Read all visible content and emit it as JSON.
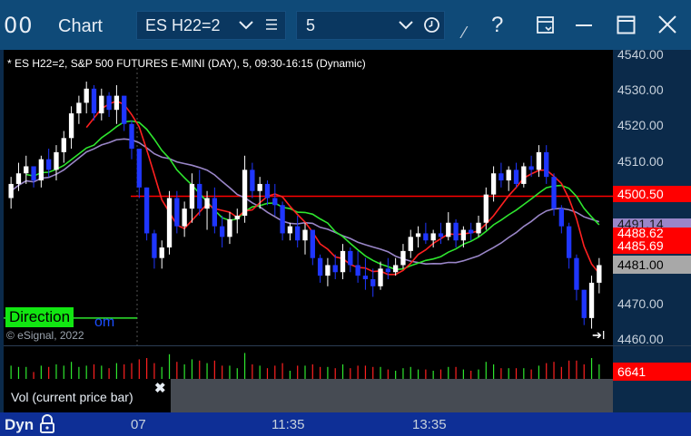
{
  "titlebar": {
    "link_glyph": "00",
    "title": "Chart",
    "symbol": "ES H22=2",
    "interval": "5",
    "help_glyph": "?",
    "cursor_glyph": "⁄",
    "icons": [
      "link-icon",
      "chevron-down-icon",
      "list-icon",
      "clock-icon",
      "cursor-icon",
      "help-icon",
      "template-icon",
      "minimize-icon",
      "maximize-icon",
      "close-icon"
    ]
  },
  "chart": {
    "title": "* ES H22=2, S&P 500 FUTURES E-MINI (DAY), 5, 09:30-16:15 (Dynamic)",
    "indicator_label": "Direction",
    "indicator_label_suffix": "om",
    "copyright": "© eSignal, 2022",
    "jump_glyph": "➔I",
    "price_ticks": [
      "4540.00",
      "4530.00",
      "4520.00",
      "4510.00",
      "4500.50",
      "4491.14",
      "4488.62",
      "4485.69",
      "4481.00",
      "4470.00",
      "4460.00"
    ],
    "price_badges": [
      {
        "label": "4500.50",
        "bg": "#ff0000",
        "fg": "#ffffff"
      },
      {
        "label": "4491.14",
        "bg": "#9a86c8",
        "fg": "#1a1a1a"
      },
      {
        "label": "4488.62",
        "bg": "#ff0000",
        "fg": "#ffffff"
      },
      {
        "label": "4485.69",
        "bg": "#ff0000",
        "fg": "#ffffff"
      },
      {
        "label": "4481.00",
        "bg": "#a8a8a8",
        "fg": "#000000"
      }
    ],
    "colors": {
      "up": "#ffffff",
      "down": "#1f36ff",
      "ma_fast": "#ff2020",
      "ma_slow": "#2ee62e",
      "vwap": "#9a86c8",
      "level": "#ff0000",
      "level_green": "#2ee62e"
    }
  },
  "chart_data": {
    "type": "candlestick",
    "symbol": "ES H22=2",
    "ylim": [
      4458,
      4542
    ],
    "candles": [
      [
        4500,
        4506,
        4497,
        4504
      ],
      [
        4504,
        4510,
        4502,
        4507
      ],
      [
        4507,
        4512,
        4504,
        4509
      ],
      [
        4509,
        4507,
        4503,
        4505
      ],
      [
        4505,
        4512,
        4503,
        4511
      ],
      [
        4511,
        4514,
        4506,
        4508
      ],
      [
        4508,
        4515,
        4505,
        4513
      ],
      [
        4513,
        4519,
        4510,
        4517
      ],
      [
        4517,
        4526,
        4514,
        4524
      ],
      [
        4524,
        4529,
        4521,
        4527
      ],
      [
        4527,
        4533,
        4524,
        4531
      ],
      [
        4531,
        4532,
        4522,
        4524
      ],
      [
        4524,
        4531,
        4522,
        4529
      ],
      [
        4529,
        4530,
        4523,
        4525
      ],
      [
        4525,
        4532,
        4521,
        4529
      ],
      [
        4529,
        4529,
        4519,
        4521
      ],
      [
        4521,
        4522,
        4511,
        4514
      ],
      [
        4514,
        4514,
        4500,
        4503
      ],
      [
        4503,
        4503,
        4488,
        4490
      ],
      [
        4490,
        4491,
        4480,
        4483
      ],
      [
        4483,
        4488,
        4480,
        4486
      ],
      [
        4486,
        4502,
        4484,
        4500
      ],
      [
        4500,
        4502,
        4490,
        4492
      ],
      [
        4492,
        4499,
        4489,
        4497
      ],
      [
        4497,
        4507,
        4493,
        4504
      ],
      [
        4504,
        4508,
        4495,
        4497
      ],
      [
        4497,
        4502,
        4491,
        4500
      ],
      [
        4500,
        4503,
        4490,
        4492
      ],
      [
        4492,
        4495,
        4486,
        4489
      ],
      [
        4489,
        4496,
        4487,
        4494
      ],
      [
        4494,
        4497,
        4490,
        4495
      ],
      [
        4495,
        4512,
        4493,
        4508
      ],
      [
        4508,
        4510,
        4500,
        4502
      ],
      [
        4502,
        4506,
        4497,
        4504
      ],
      [
        4504,
        4505,
        4498,
        4500
      ],
      [
        4500,
        4504,
        4495,
        4498
      ],
      [
        4498,
        4499,
        4488,
        4490
      ],
      [
        4490,
        4493,
        4488,
        4492
      ],
      [
        4492,
        4495,
        4486,
        4488
      ],
      [
        4488,
        4493,
        4484,
        4491
      ],
      [
        4491,
        4491,
        4481,
        4483
      ],
      [
        4483,
        4484,
        4476,
        4478
      ],
      [
        4478,
        4483,
        4475,
        4481
      ],
      [
        4481,
        4484,
        4477,
        4479
      ],
      [
        4479,
        4487,
        4477,
        4485
      ],
      [
        4485,
        4486,
        4479,
        4481
      ],
      [
        4481,
        4485,
        4476,
        4478
      ],
      [
        4478,
        4483,
        4474,
        4477
      ],
      [
        4477,
        4480,
        4472,
        4475
      ],
      [
        4475,
        4482,
        4474,
        4480
      ],
      [
        4480,
        4483,
        4477,
        4479
      ],
      [
        4479,
        4483,
        4478,
        4481
      ],
      [
        4481,
        4487,
        4480,
        4485
      ],
      [
        4485,
        4491,
        4483,
        4489
      ],
      [
        4489,
        4492,
        4486,
        4490
      ],
      [
        4490,
        4493,
        4487,
        4488
      ],
      [
        4488,
        4491,
        4486,
        4490
      ],
      [
        4490,
        4493,
        4487,
        4489
      ],
      [
        4489,
        4496,
        4488,
        4493
      ],
      [
        4493,
        4494,
        4486,
        4488
      ],
      [
        4488,
        4492,
        4486,
        4491
      ],
      [
        4491,
        4493,
        4488,
        4490
      ],
      [
        4490,
        4495,
        4489,
        4493
      ],
      [
        4493,
        4503,
        4491,
        4501
      ],
      [
        4501,
        4509,
        4499,
        4507
      ],
      [
        4507,
        4510,
        4503,
        4505
      ],
      [
        4505,
        4509,
        4502,
        4508
      ],
      [
        4508,
        4510,
        4503,
        4504
      ],
      [
        4504,
        4510,
        4503,
        4509
      ],
      [
        4509,
        4512,
        4506,
        4508
      ],
      [
        4508,
        4515,
        4506,
        4513
      ],
      [
        4513,
        4515,
        4504,
        4506
      ],
      [
        4506,
        4507,
        4495,
        4497
      ],
      [
        4497,
        4498,
        4490,
        4492
      ],
      [
        4492,
        4493,
        4480,
        4483
      ],
      [
        4483,
        4484,
        4471,
        4474
      ],
      [
        4474,
        4474,
        4464,
        4466
      ],
      [
        4466,
        4478,
        4463,
        4476
      ],
      [
        4476,
        4483,
        4473,
        4481
      ]
    ],
    "volume_latest": "6641",
    "time_labels": [
      "07",
      "11:35",
      "13:35"
    ]
  },
  "volume": {
    "badge": "6641",
    "tooltip": "Vol (current price bar)",
    "tooltip_close": "✖"
  },
  "timeaxis": {
    "mode": "Dyn",
    "labels": [
      "07",
      "11:35",
      "13:35"
    ]
  }
}
